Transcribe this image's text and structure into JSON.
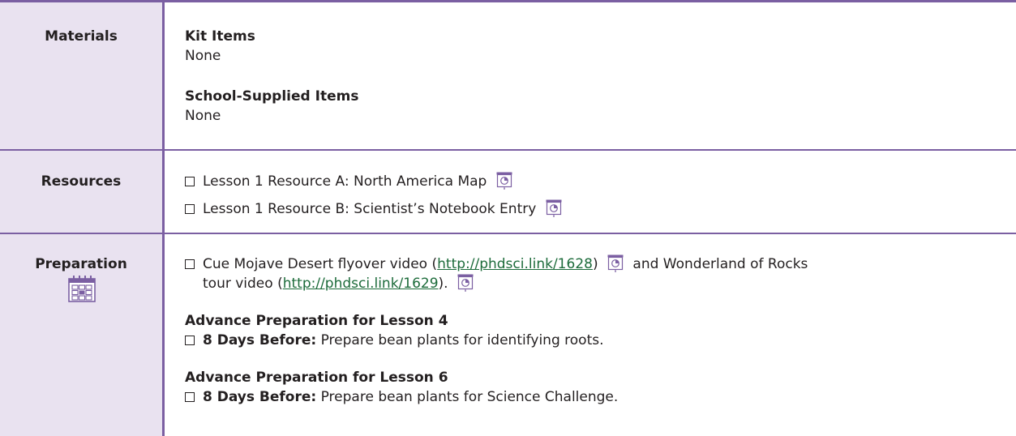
{
  "materials": {
    "heading": "Materials",
    "kit_label": "Kit Items",
    "kit_value": "None",
    "school_label": "School-Supplied Items",
    "school_value": "None"
  },
  "resources": {
    "heading": "Resources",
    "items": [
      "Lesson 1 Resource A: North America Map",
      "Lesson 1 Resource B: Scientist’s Notebook Entry"
    ]
  },
  "preparation": {
    "heading": "Preparation",
    "cue_prefix": "Cue Mojave Desert flyover video (",
    "link1": "http://phdsci.link/1628",
    "cue_mid1": ")",
    "cue_mid2": "and Wonderland of Rocks",
    "cue_mid3": "tour video (",
    "link2": "http://phdsci.link/1629",
    "cue_end": ").",
    "lesson4_heading": "Advance Preparation for Lesson 4",
    "lesson4_bold": "8 Days Before:",
    "lesson4_text": "Prepare bean plants for identifying roots.",
    "lesson6_heading": "Advance Preparation for Lesson 6",
    "lesson6_bold": "8 Days Before:",
    "lesson6_text": "Prepare bean plants for Science Challenge."
  },
  "colors": {
    "rule": "#7b5fa2",
    "label_bg": "#e9e2f0",
    "link": "#1c6b3a",
    "icon": "#7b5fa2"
  },
  "icons": {
    "slide": "projector-slide-icon",
    "calendar": "calendar-icon"
  }
}
